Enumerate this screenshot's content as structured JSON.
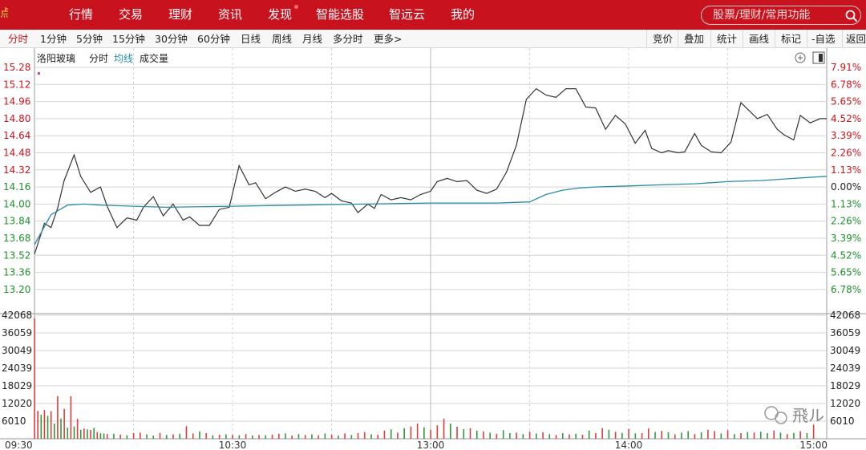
{
  "topbar": {
    "logo_glyph": "点",
    "nav": [
      "行情",
      "交易",
      "理财",
      "资讯",
      "发现",
      "智能选股",
      "智远云",
      "我的"
    ],
    "search_placeholder": "股票/理财/常用功能",
    "colors": {
      "bar_bg": "#c8121d",
      "text": "#ffffff"
    }
  },
  "toolbar": {
    "periods": [
      "分时",
      "1分钟",
      "5分钟",
      "15分钟",
      "30分钟",
      "60分钟",
      "日线",
      "周线",
      "月线",
      "多分时",
      "更多>"
    ],
    "active": "分时",
    "actions": [
      "竞价",
      "叠加",
      "统计",
      "画线",
      "标记",
      "-自选",
      "返回"
    ]
  },
  "legend": {
    "stock_name": "洛阳玻璃",
    "items": [
      "分时",
      "均线",
      "成交量"
    ],
    "avg_color": "#2a8aa8"
  },
  "watermark": {
    "text": "飛ル"
  },
  "chart_data": {
    "type": "line",
    "title": "",
    "price_axis": {
      "ticks": [
        15.28,
        15.12,
        14.96,
        14.8,
        14.64,
        14.48,
        14.32,
        14.16,
        14.0,
        13.84,
        13.68,
        13.52,
        13.36,
        13.2
      ],
      "tick_labels": [
        "15.28",
        "15.12",
        "14.96",
        "14.80",
        "14.64",
        "14.48",
        "14.32",
        "14.16",
        "14.00",
        "13.84",
        "13.68",
        "13.52",
        "13.36",
        "13.20"
      ],
      "red_count": 7,
      "ylim": [
        13.12,
        15.36
      ]
    },
    "pct_axis": {
      "labels": [
        "7.91%",
        "6.78%",
        "5.65%",
        "4.52%",
        "3.39%",
        "2.26%",
        "1.13%",
        "0.00%",
        "1.13%",
        "2.26%",
        "3.39%",
        "4.52%",
        "5.65%",
        "6.78%"
      ],
      "zero_index": 7
    },
    "volume_axis": {
      "ticks": [
        42068,
        36059,
        30049,
        24039,
        18029,
        12020,
        6010
      ],
      "tick_labels": [
        "42068",
        "36059",
        "30049",
        "24039",
        "18029",
        "12020",
        "6010"
      ],
      "ylim": [
        0,
        42068
      ]
    },
    "time_axis": {
      "labels": [
        "09:30",
        "10:30",
        "13:00",
        "14:00",
        "15:00"
      ],
      "range_minutes": [
        0,
        240
      ]
    },
    "series": [
      {
        "name": "分时",
        "color": "#333333",
        "x": [
          0,
          3,
          5,
          7,
          9,
          12,
          14,
          17,
          20,
          22,
          25,
          28,
          31,
          33,
          36,
          39,
          42,
          45,
          47,
          50,
          53,
          56,
          59,
          62,
          65,
          67,
          70,
          73,
          76,
          79,
          82,
          85,
          88,
          90,
          93,
          96,
          98,
          101,
          103,
          105,
          108,
          111,
          114,
          117,
          120,
          122,
          125,
          128,
          131,
          134,
          137,
          140,
          143,
          146,
          149,
          152,
          155,
          158,
          161,
          164,
          167,
          170,
          173,
          176,
          179,
          182,
          185,
          187,
          190,
          192,
          195,
          197,
          200,
          202,
          205,
          208,
          211,
          214,
          216,
          219,
          222,
          225,
          227,
          230,
          232,
          235,
          238,
          240
        ],
        "y": [
          13.53,
          13.82,
          13.78,
          13.96,
          14.22,
          14.46,
          14.26,
          14.11,
          14.16,
          13.98,
          13.78,
          13.87,
          13.85,
          13.97,
          14.07,
          13.89,
          14.0,
          13.85,
          13.88,
          13.8,
          13.8,
          13.95,
          13.97,
          14.36,
          14.18,
          14.2,
          14.05,
          14.11,
          14.16,
          14.12,
          14.14,
          14.12,
          14.06,
          14.1,
          14.03,
          14.01,
          13.92,
          14.0,
          13.96,
          14.09,
          14.04,
          14.06,
          14.04,
          14.09,
          14.12,
          14.21,
          14.24,
          14.21,
          14.22,
          14.13,
          14.1,
          14.14,
          14.3,
          14.55,
          14.98,
          15.08,
          15.02,
          15.0,
          15.08,
          15.08,
          14.91,
          14.9,
          14.7,
          14.83,
          14.75,
          14.57,
          14.69,
          14.52,
          14.48,
          14.5,
          14.48,
          14.49,
          14.66,
          14.55,
          14.49,
          14.48,
          14.58,
          14.95,
          14.89,
          14.8,
          14.84,
          14.7,
          14.65,
          14.6,
          14.83,
          14.76,
          14.8,
          14.8
        ]
      },
      {
        "name": "均线",
        "color": "#2a8aa8",
        "x": [
          0,
          5,
          10,
          15,
          20,
          30,
          40,
          60,
          80,
          100,
          120,
          140,
          150,
          155,
          160,
          165,
          170,
          180,
          190,
          200,
          210,
          220,
          230,
          240
        ],
        "y": [
          13.62,
          13.9,
          13.99,
          14.0,
          13.99,
          13.98,
          13.97,
          13.98,
          13.99,
          14.0,
          14.01,
          14.01,
          14.02,
          14.09,
          14.13,
          14.15,
          14.16,
          14.17,
          14.18,
          14.19,
          14.21,
          14.22,
          14.24,
          14.26
        ]
      }
    ],
    "volume": {
      "x": [
        0,
        1,
        2,
        3,
        4,
        5,
        6,
        7,
        8,
        9,
        10,
        11,
        12,
        13,
        14,
        15,
        16,
        17,
        18,
        19,
        20,
        21,
        22,
        24,
        26,
        28,
        30,
        32,
        34,
        36,
        38,
        40,
        42,
        44,
        46,
        48,
        50,
        52,
        54,
        56,
        58,
        60,
        62,
        64,
        66,
        68,
        70,
        72,
        74,
        76,
        78,
        80,
        82,
        84,
        86,
        88,
        90,
        92,
        94,
        96,
        98,
        100,
        102,
        104,
        106,
        108,
        110,
        112,
        114,
        116,
        118,
        120,
        122,
        124,
        126,
        128,
        130,
        132,
        134,
        136,
        138,
        140,
        142,
        144,
        146,
        148,
        150,
        152,
        154,
        156,
        158,
        160,
        162,
        164,
        166,
        168,
        170,
        172,
        174,
        176,
        178,
        180,
        182,
        184,
        186,
        188,
        190,
        192,
        194,
        196,
        198,
        200,
        202,
        204,
        206,
        208,
        210,
        212,
        214,
        216,
        218,
        220,
        222,
        224,
        226,
        228,
        230,
        232,
        234,
        236,
        238
      ],
      "values": [
        41000,
        9500,
        8200,
        9800,
        7800,
        9400,
        5200,
        14500,
        6900,
        10200,
        3800,
        14500,
        4200,
        6800,
        3100,
        3500,
        3200,
        3000,
        3700,
        2300,
        1900,
        1800,
        1600,
        1700,
        1400,
        1200,
        1900,
        2100,
        1500,
        1100,
        2000,
        1300,
        1500,
        1700,
        4300,
        1800,
        2500,
        1900,
        1200,
        1400,
        1500,
        1300,
        1200,
        1600,
        1100,
        1300,
        1200,
        1400,
        1700,
        1800,
        1100,
        1600,
        1300,
        1500,
        1200,
        1800,
        1400,
        1100,
        1800,
        1300,
        1900,
        2200,
        1500,
        1400,
        2800,
        3200,
        2100,
        3600,
        4200,
        5200,
        3900,
        3100,
        4600,
        6800,
        5200,
        4100,
        3300,
        3600,
        2800,
        2500,
        2100,
        1700,
        2900,
        1900,
        2100,
        1600,
        2400,
        1800,
        2200,
        1600,
        1300,
        1900,
        1500,
        1700,
        1400,
        2800,
        1900,
        3600,
        3100,
        2400,
        2000,
        3300,
        1800,
        1900,
        3500,
        2300,
        2700,
        2200,
        1500,
        2100,
        2600,
        1600,
        2200,
        3100,
        2600,
        1800,
        2900,
        1600,
        1900,
        2300,
        2100,
        2400,
        1900,
        2800,
        2100,
        1600,
        2000,
        2600,
        1900,
        4800
      ],
      "up": [
        1,
        1,
        0,
        1,
        0,
        1,
        0,
        1,
        0,
        1,
        0,
        1,
        0,
        1,
        0,
        1,
        0,
        1,
        0,
        1,
        0,
        0,
        1,
        0,
        1,
        0,
        1,
        1,
        0,
        0,
        1,
        0,
        1,
        0,
        1,
        1,
        0,
        1,
        0,
        1,
        0,
        1,
        0,
        1,
        0,
        1,
        0,
        1,
        1,
        0,
        1,
        0,
        1,
        0,
        1,
        0,
        1,
        0,
        1,
        0,
        1,
        1,
        0,
        1,
        1,
        0,
        1,
        0,
        1,
        1,
        0,
        1,
        1,
        1,
        0,
        1,
        0,
        1,
        0,
        1,
        0,
        1,
        0,
        0,
        1,
        0,
        1,
        0,
        1,
        0,
        1,
        0,
        1,
        0,
        1,
        0,
        1,
        1,
        0,
        1,
        0,
        1,
        0,
        1,
        1,
        0,
        1,
        0,
        1,
        0,
        0,
        1,
        0,
        1,
        1,
        0,
        1,
        0,
        1,
        0,
        1,
        0,
        0,
        1,
        0,
        1,
        0,
        1,
        0,
        1,
        0,
        1
      ]
    },
    "colors": {
      "up": "#e03c3c",
      "down": "#2e9a3a",
      "grid": "#d4d4d4",
      "price_up_text": "#d0121b",
      "price_down_text": "#1d8f2a"
    }
  }
}
